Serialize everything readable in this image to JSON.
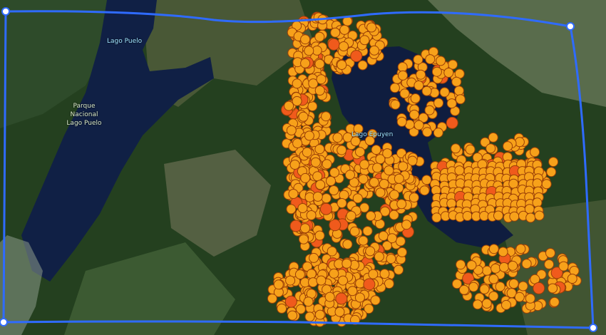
{
  "map": {
    "labels": {
      "lago_puelo": "Lago Puelo",
      "parque_line1": "Parque",
      "parque_line2": "Nacional",
      "parque_line3": "Lago Puelo",
      "lago_epuyen": "Lago Epuyen"
    },
    "colors": {
      "forest": "#1f3a1f",
      "water": "#0f1f45",
      "point_fill": "#f7a11a",
      "point_stroke": "#9a3f07",
      "point_hot": "#f05a1c",
      "polygon_stroke": "#2f6bff",
      "vertex_fill": "#ffffff"
    },
    "icons": {
      "vertex_handle": "vertex-handle-icon",
      "fire_point": "fire-point-icon"
    }
  }
}
